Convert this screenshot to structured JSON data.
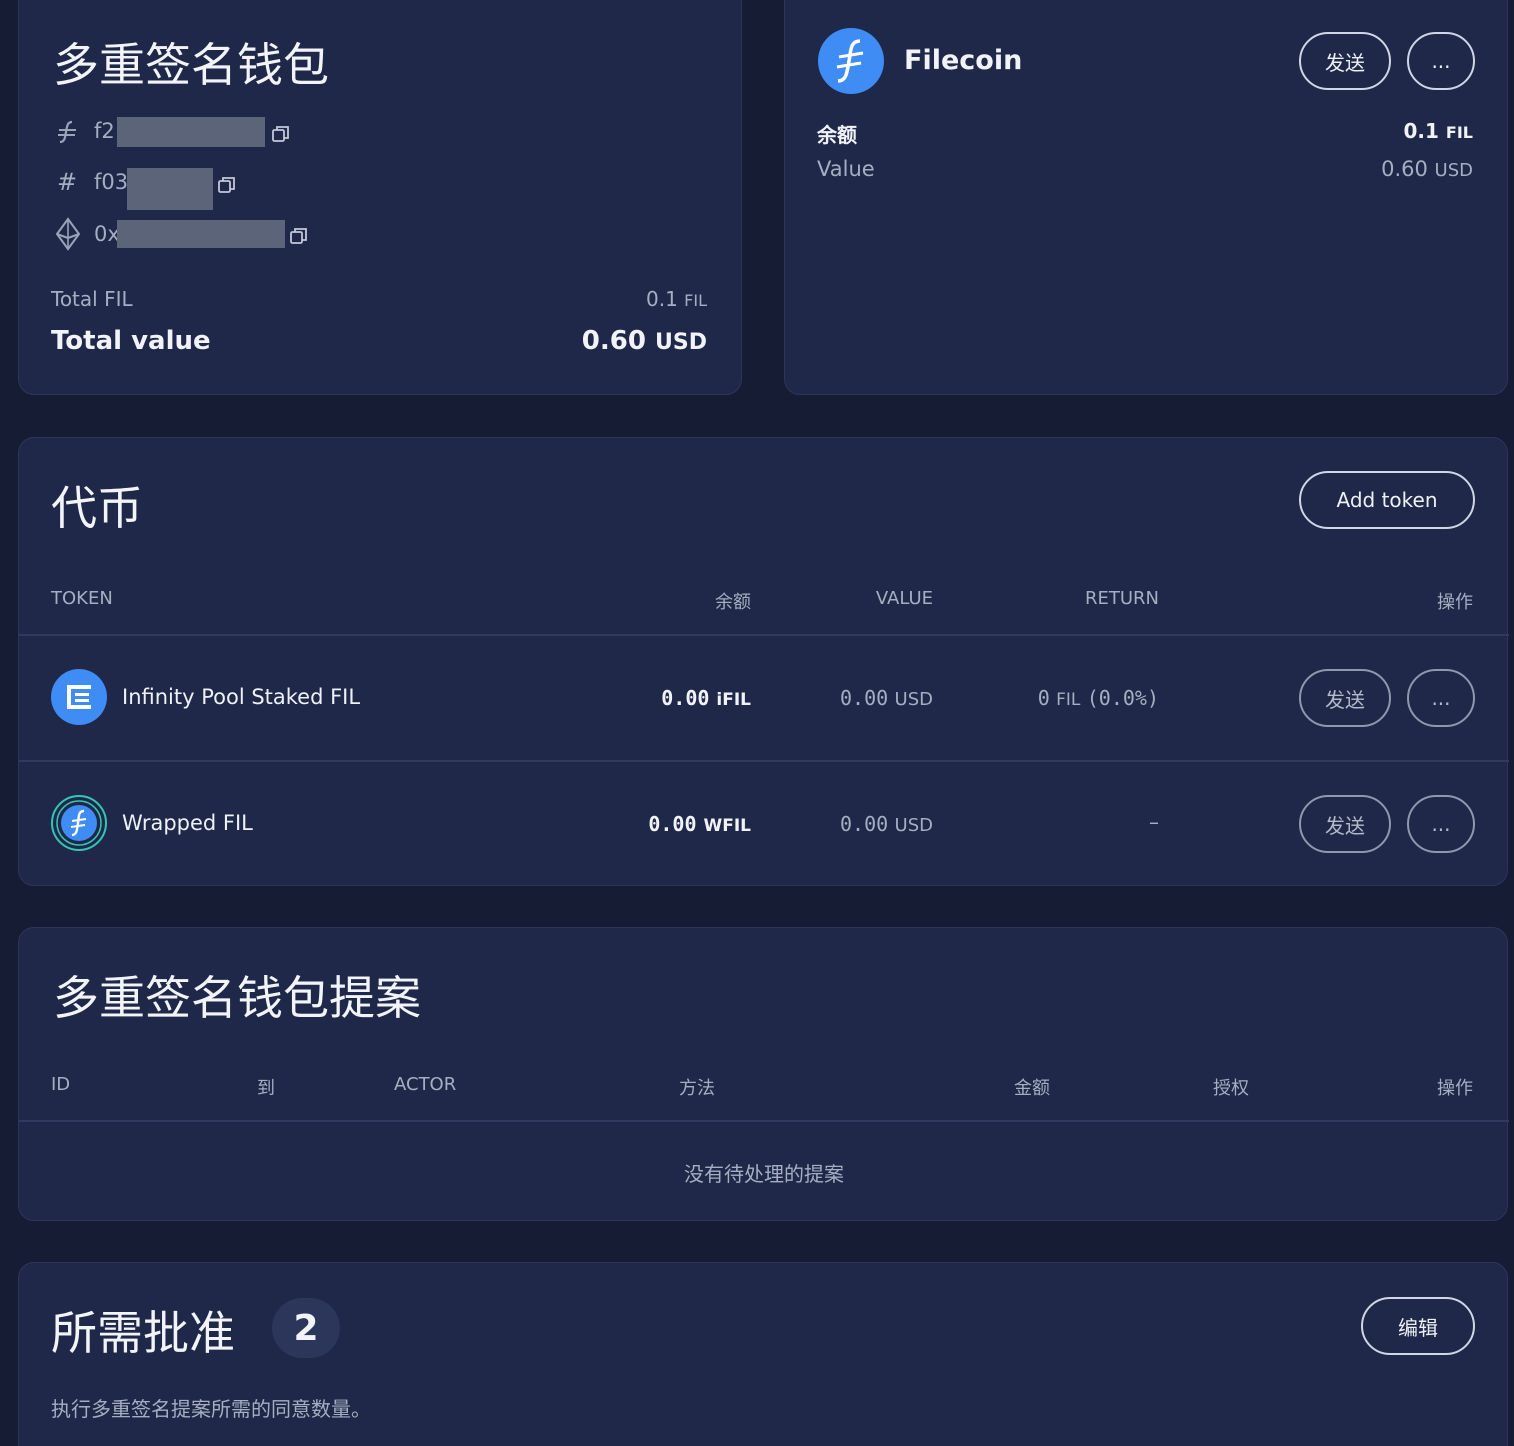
{
  "wallet": {
    "title": "多重签名钱包",
    "addresses": [
      {
        "icon": "filecoin-icon",
        "prefix": "f2"
      },
      {
        "icon": "hash-icon",
        "prefix": "f03"
      },
      {
        "icon": "ethereum-icon",
        "prefix": "0x"
      }
    ],
    "total_fil_label": "Total FIL",
    "total_fil_value": "0.1",
    "total_fil_unit": "FIL",
    "total_value_label": "Total value",
    "total_value_value": "0.60",
    "total_value_unit": "USD"
  },
  "filecoin_card": {
    "name": "Filecoin",
    "send_label": "发送",
    "more_label": "...",
    "balance_label": "余额",
    "balance_value": "0.1",
    "balance_unit": "FIL",
    "value_label": "Value",
    "value_value": "0.60",
    "value_unit": "USD"
  },
  "tokens": {
    "title": "代币",
    "add_token_label": "Add token",
    "columns": {
      "token": "TOKEN",
      "balance": "余额",
      "value": "VALUE",
      "return": "RETURN",
      "actions": "操作"
    },
    "rows": [
      {
        "name": "Infinity Pool Staked FIL",
        "balance": "0.00",
        "balance_unit": "iFIL",
        "value": "0.00",
        "value_unit": "USD",
        "return_amount": "0",
        "return_unit": "FIL",
        "return_pct": "(0.0%)",
        "send_label": "发送",
        "more_label": "..."
      },
      {
        "name": "Wrapped FIL",
        "balance": "0.00",
        "balance_unit": "WFIL",
        "value": "0.00",
        "value_unit": "USD",
        "return_dash": "–",
        "send_label": "发送",
        "more_label": "..."
      }
    ]
  },
  "proposals": {
    "title": "多重签名钱包提案",
    "columns": {
      "id": "ID",
      "to": "到",
      "actor": "ACTOR",
      "method": "方法",
      "amount": "金额",
      "approvals": "授权",
      "actions": "操作"
    },
    "empty_text": "没有待处理的提案"
  },
  "approvals": {
    "title": "所需批准",
    "count": "2",
    "edit_label": "编辑",
    "description": "执行多重签名提案所需的同意数量。"
  },
  "colors": {
    "background": "#161c33",
    "card": "#1f2848",
    "filecoin_blue": "#3f8cf5",
    "teal": "#34c6b2"
  }
}
